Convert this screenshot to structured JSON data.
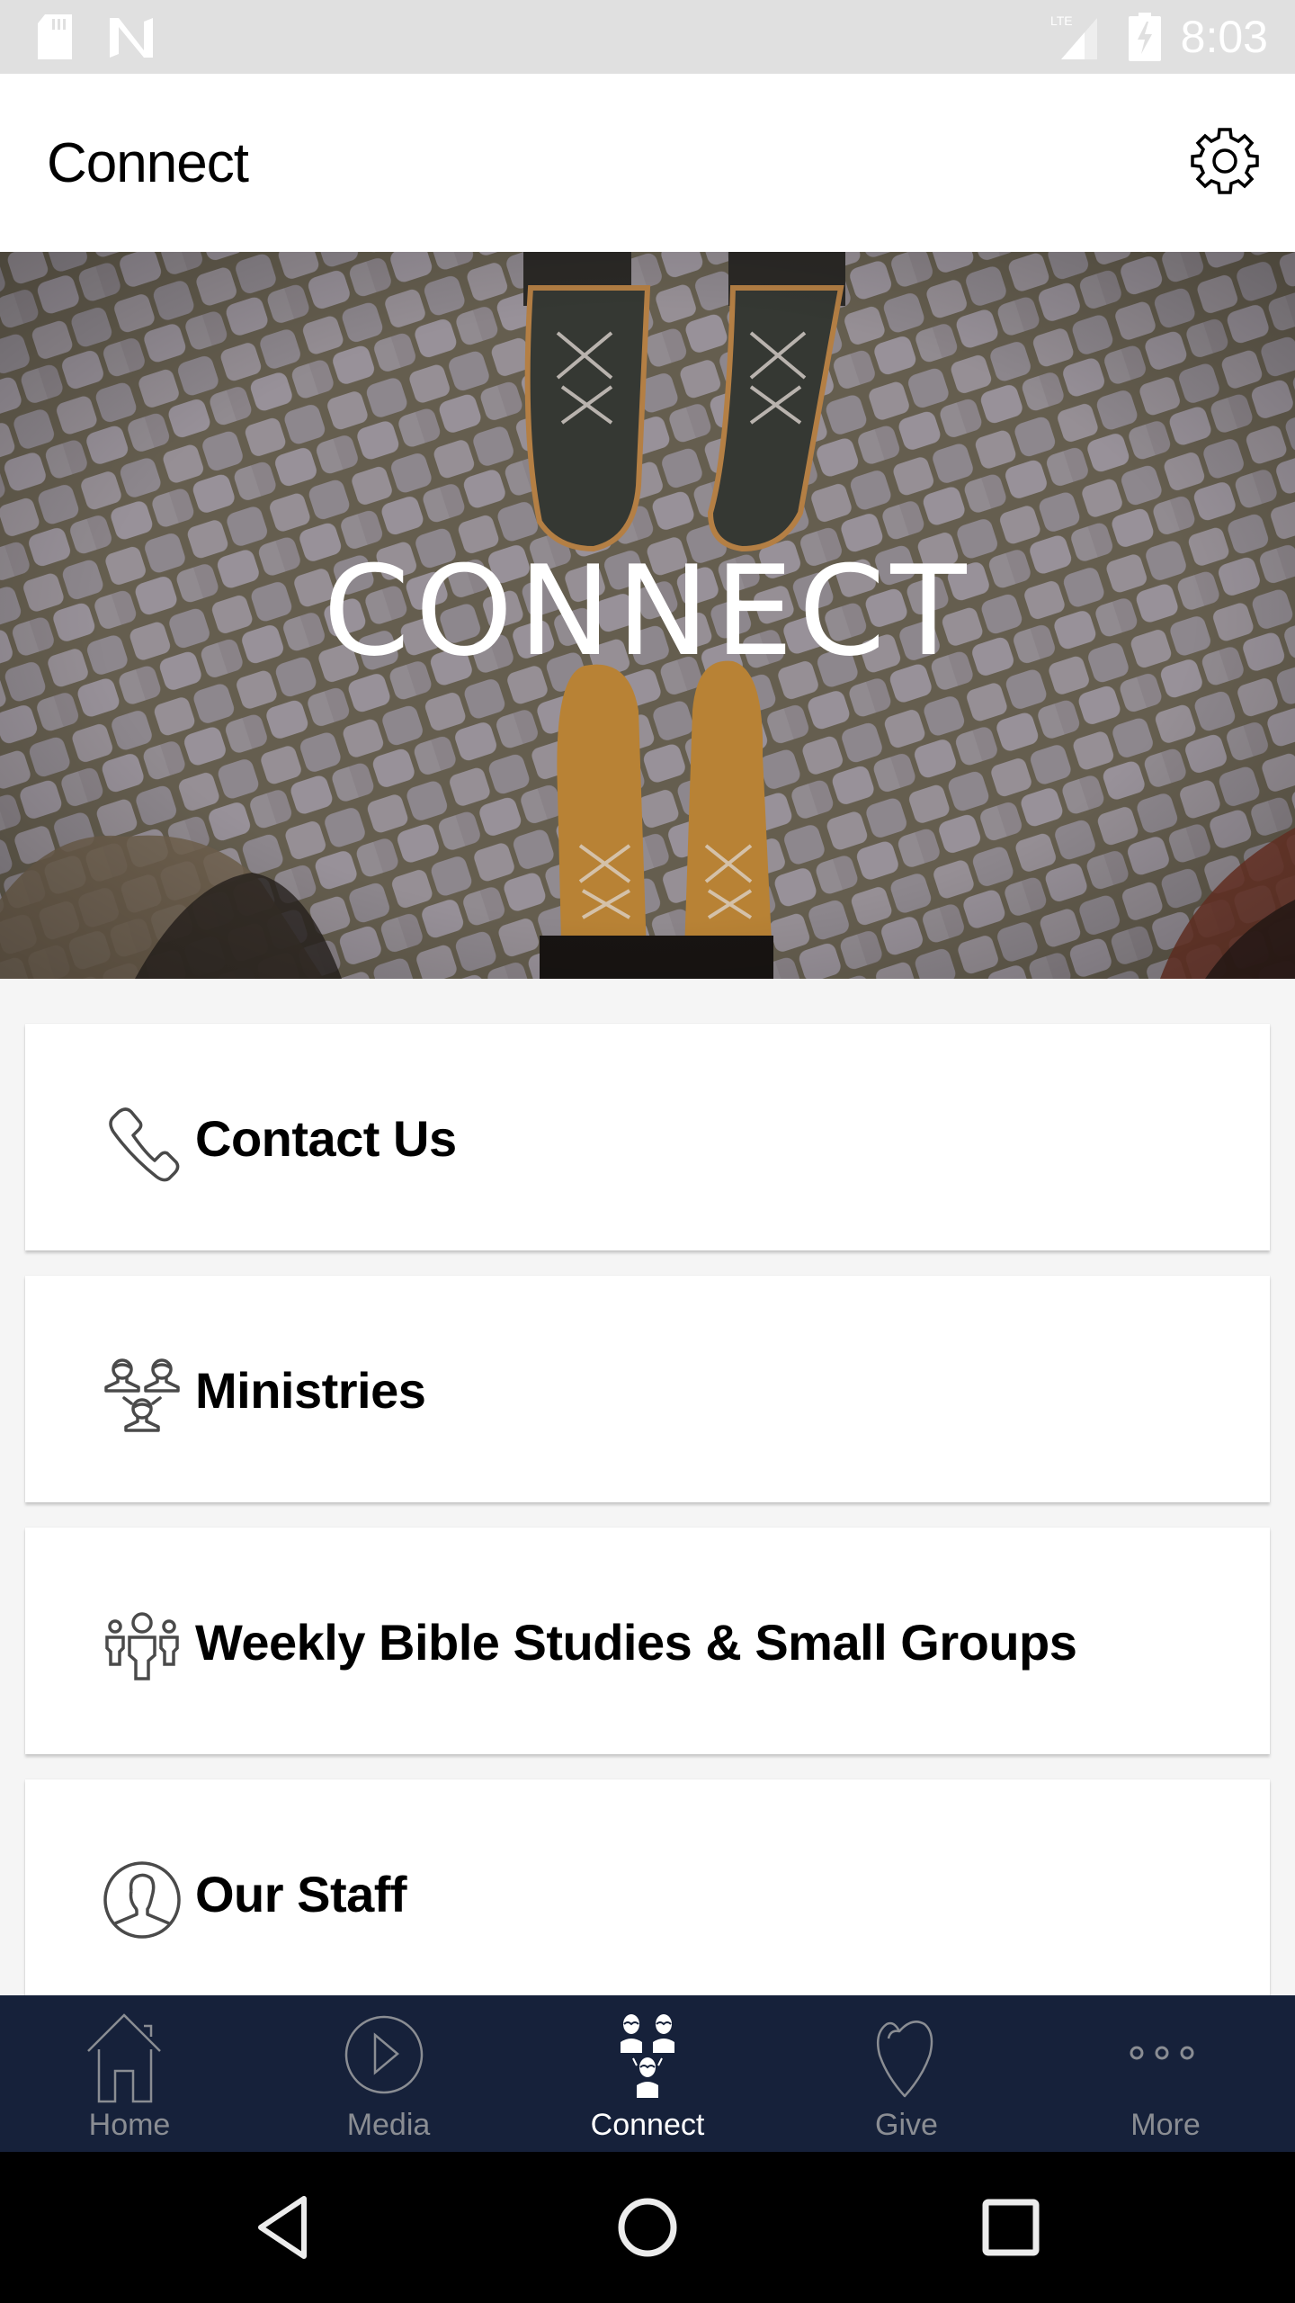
{
  "status_bar": {
    "time": "8:03",
    "icons": [
      "sd-card-icon",
      "n-notification-icon",
      "lte-signal-icon",
      "battery-charging-icon"
    ],
    "network_label": "LTE"
  },
  "app_bar": {
    "title": "Connect",
    "settings_icon": "gear-icon"
  },
  "hero": {
    "title": "CONNECT",
    "image_description": "two pairs of boots facing each other on cobblestone"
  },
  "cards": [
    {
      "label": "Contact Us",
      "icon": "phone-icon"
    },
    {
      "label": "Ministries",
      "icon": "people-network-icon"
    },
    {
      "label": "Weekly Bible Studies & Small Groups",
      "icon": "group-icon"
    },
    {
      "label": "Our Staff",
      "icon": "person-circle-icon"
    }
  ],
  "tab_bar": {
    "active": "Connect",
    "tabs": [
      {
        "label": "Home",
        "icon": "home-icon"
      },
      {
        "label": "Media",
        "icon": "play-circle-icon"
      },
      {
        "label": "Connect",
        "icon": "people-network-icon"
      },
      {
        "label": "Give",
        "icon": "heart-icon"
      },
      {
        "label": "More",
        "icon": "more-dots-icon"
      }
    ]
  },
  "colors": {
    "status_bar_bg": "#e0e0e0",
    "tab_bar_bg": "#16213a",
    "tab_inactive": "#8a8d93",
    "tab_active": "#ffffff",
    "content_bg": "#f5f5f5",
    "icon_gray": "#4a4a4a"
  }
}
